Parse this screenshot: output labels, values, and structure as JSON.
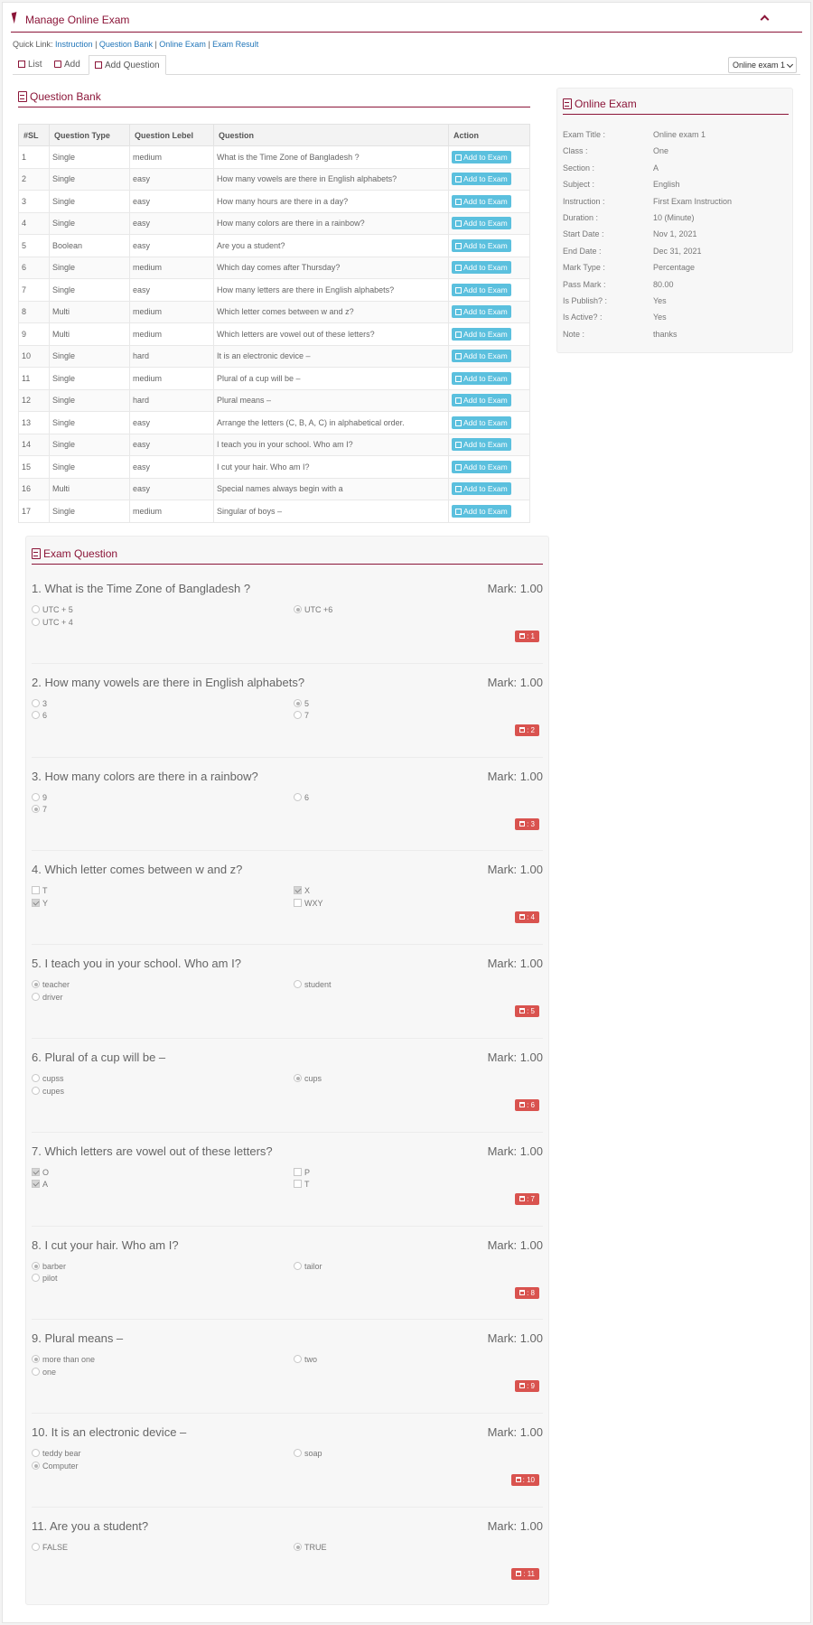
{
  "header": {
    "title": "Manage Online Exam"
  },
  "quick_link": {
    "label": "Quick Link: ",
    "links": [
      "Instruction",
      "Question Bank",
      "Online Exam",
      "Exam Result"
    ]
  },
  "tabs": [
    {
      "label": "List"
    },
    {
      "label": "Add"
    },
    {
      "label": "Add Question"
    }
  ],
  "exam_select": {
    "value": "Online exam 1"
  },
  "question_bank": {
    "title": "Question Bank",
    "columns": [
      "#SL",
      "Question Type",
      "Question Lebel",
      "Question",
      "Action"
    ],
    "action_label": "Add to Exam",
    "rows": [
      [
        "1",
        "Single",
        "medium",
        "What is the Time Zone of Bangladesh ?"
      ],
      [
        "2",
        "Single",
        "easy",
        "How many vowels are there in English alphabets?"
      ],
      [
        "3",
        "Single",
        "easy",
        "How many hours are there in a day?"
      ],
      [
        "4",
        "Single",
        "easy",
        "How many colors are there in a rainbow?"
      ],
      [
        "5",
        "Boolean",
        "easy",
        "Are you a student?"
      ],
      [
        "6",
        "Single",
        "medium",
        "Which day comes after Thursday?"
      ],
      [
        "7",
        "Single",
        "easy",
        "How many letters are there in English alphabets?"
      ],
      [
        "8",
        "Multi",
        "medium",
        "Which letter comes between w and z?"
      ],
      [
        "9",
        "Multi",
        "medium",
        "Which letters are vowel out of these letters?"
      ],
      [
        "10",
        "Single",
        "hard",
        "It is an electronic device –"
      ],
      [
        "11",
        "Single",
        "medium",
        "Plural of a cup will be –"
      ],
      [
        "12",
        "Single",
        "hard",
        "Plural means –"
      ],
      [
        "13",
        "Single",
        "easy",
        "Arrange the letters (C, B, A, C) in alphabetical order."
      ],
      [
        "14",
        "Single",
        "easy",
        "I teach you in your school. Who am I?"
      ],
      [
        "15",
        "Single",
        "easy",
        "I cut your hair. Who am I?"
      ],
      [
        "16",
        "Multi",
        "easy",
        "Special names always begin with a"
      ],
      [
        "17",
        "Single",
        "medium",
        "Singular of boys –"
      ]
    ]
  },
  "online_exam": {
    "title": "Online Exam",
    "fields": [
      {
        "key": "Exam Title :",
        "value": "Online exam 1"
      },
      {
        "key": "Class :",
        "value": "One"
      },
      {
        "key": "Section :",
        "value": "A"
      },
      {
        "key": "Subject :",
        "value": "English"
      },
      {
        "key": "Instruction :",
        "value": "First Exam Instruction"
      },
      {
        "key": "Duration :",
        "value": "10 (Minute)"
      },
      {
        "key": "Start Date :",
        "value": "Nov 1, 2021"
      },
      {
        "key": "End Date :",
        "value": "Dec 31, 2021"
      },
      {
        "key": "Mark Type :",
        "value": "Percentage"
      },
      {
        "key": "Pass Mark :",
        "value": "80.00"
      },
      {
        "key": "Is Publish? :",
        "value": "Yes"
      },
      {
        "key": "Is Active? :",
        "value": "Yes"
      },
      {
        "key": "Note :",
        "value": "thanks"
      }
    ]
  },
  "exam_question": {
    "title": "Exam Question",
    "questions": [
      {
        "title": "1. What is the Time Zone of Bangladesh ?",
        "mark": "Mark: 1.00",
        "input": "radio",
        "options": [
          {
            "t": "UTC + 5",
            "c": false
          },
          {
            "t": "UTC +6",
            "c": true
          },
          {
            "t": "UTC + 4",
            "c": false
          }
        ],
        "del": ": 1"
      },
      {
        "title": "2. How many vowels are there in English alphabets?",
        "mark": "Mark: 1.00",
        "input": "radio",
        "options": [
          {
            "t": "3",
            "c": false
          },
          {
            "t": "5",
            "c": true
          },
          {
            "t": "6",
            "c": false
          },
          {
            "t": "7",
            "c": false
          }
        ],
        "del": ": 2"
      },
      {
        "title": "3. How many colors are there in a rainbow?",
        "mark": "Mark: 1.00",
        "input": "radio",
        "options": [
          {
            "t": "9",
            "c": false
          },
          {
            "t": "6",
            "c": false
          },
          {
            "t": "7",
            "c": true
          }
        ],
        "del": ": 3"
      },
      {
        "title": "4. Which letter comes between w and z?",
        "mark": "Mark: 1.00",
        "input": "check",
        "options": [
          {
            "t": "T",
            "c": false
          },
          {
            "t": "X",
            "c": true
          },
          {
            "t": "Y",
            "c": true
          },
          {
            "t": "WXY",
            "c": false
          }
        ],
        "del": ": 4"
      },
      {
        "title": "5. I teach you in your school. Who am I?",
        "mark": "Mark: 1.00",
        "input": "radio",
        "options": [
          {
            "t": "teacher",
            "c": true
          },
          {
            "t": "student",
            "c": false
          },
          {
            "t": "driver",
            "c": false
          }
        ],
        "del": ": 5"
      },
      {
        "title": "6. Plural of a cup will be –",
        "mark": "Mark: 1.00",
        "input": "radio",
        "options": [
          {
            "t": "cupss",
            "c": false
          },
          {
            "t": "cups",
            "c": true
          },
          {
            "t": "cupes",
            "c": false
          }
        ],
        "del": ": 6"
      },
      {
        "title": "7. Which letters are vowel out of these letters?",
        "mark": "Mark: 1.00",
        "input": "check",
        "options": [
          {
            "t": "O",
            "c": true
          },
          {
            "t": "P",
            "c": false
          },
          {
            "t": "A",
            "c": true
          },
          {
            "t": "T",
            "c": false
          }
        ],
        "del": ": 7"
      },
      {
        "title": "8. I cut your hair. Who am I?",
        "mark": "Mark: 1.00",
        "input": "radio",
        "options": [
          {
            "t": "barber",
            "c": true
          },
          {
            "t": "tailor",
            "c": false
          },
          {
            "t": "pilot",
            "c": false
          }
        ],
        "del": ": 8"
      },
      {
        "title": "9. Plural means –",
        "mark": "Mark: 1.00",
        "input": "radio",
        "options": [
          {
            "t": "more than one",
            "c": true
          },
          {
            "t": "two",
            "c": false
          },
          {
            "t": "one",
            "c": false
          }
        ],
        "del": ": 9"
      },
      {
        "title": "10. It is an electronic device –",
        "mark": "Mark: 1.00",
        "input": "radio",
        "options": [
          {
            "t": "teddy bear",
            "c": false
          },
          {
            "t": "soap",
            "c": false
          },
          {
            "t": "Computer",
            "c": true
          }
        ],
        "del": ": 10"
      },
      {
        "title": "11. Are you a student?",
        "mark": "Mark: 1.00",
        "input": "radio",
        "options": [
          {
            "t": "FALSE",
            "c": false
          },
          {
            "t": "TRUE",
            "c": true
          }
        ],
        "del": ": 11"
      }
    ]
  }
}
